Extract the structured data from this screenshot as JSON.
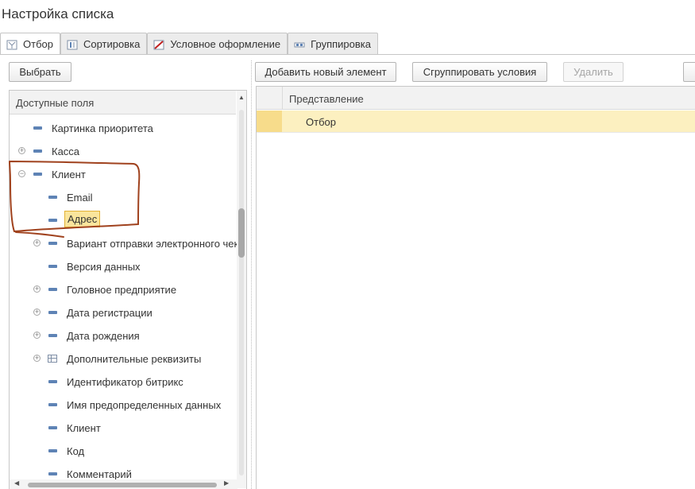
{
  "window": {
    "title": "Настройка списка"
  },
  "tabs": [
    {
      "label": "Отбор",
      "icon": "filter-icon",
      "active": true
    },
    {
      "label": "Сортировка",
      "icon": "sort-icon",
      "active": false
    },
    {
      "label": "Условное оформление",
      "icon": "conditional-format-icon",
      "active": false
    },
    {
      "label": "Группировка",
      "icon": "grouping-icon",
      "active": false
    }
  ],
  "left": {
    "select_button": "Выбрать",
    "header": "Доступные поля",
    "items": [
      {
        "label": "Картинка приоритета",
        "expandable": false,
        "icon": "field-icon"
      },
      {
        "label": "Касса",
        "expandable": true,
        "expanded": false,
        "icon": "field-icon"
      },
      {
        "label": "Клиент",
        "expandable": true,
        "expanded": true,
        "icon": "field-icon"
      },
      {
        "label": "Email",
        "expandable": false,
        "icon": "field-icon"
      },
      {
        "label": "Адрес",
        "expandable": false,
        "icon": "field-icon",
        "highlighted": true
      },
      {
        "label": "Вариант отправки электронного чек",
        "expandable": true,
        "expanded": false,
        "icon": "field-icon"
      },
      {
        "label": "Версия данных",
        "expandable": false,
        "icon": "field-icon"
      },
      {
        "label": "Головное предприятие",
        "expandable": true,
        "expanded": false,
        "icon": "field-icon"
      },
      {
        "label": "Дата регистрации",
        "expandable": true,
        "expanded": false,
        "icon": "field-icon"
      },
      {
        "label": "Дата рождения",
        "expandable": true,
        "expanded": false,
        "icon": "field-icon"
      },
      {
        "label": "Дополнительные реквизиты",
        "expandable": true,
        "expanded": false,
        "icon": "table-icon"
      },
      {
        "label": "Идентификатор битрикс",
        "expandable": false,
        "icon": "field-icon"
      },
      {
        "label": "Имя предопределенных данных",
        "expandable": false,
        "icon": "field-icon"
      },
      {
        "label": "Клиент",
        "expandable": false,
        "icon": "field-icon"
      },
      {
        "label": "Код",
        "expandable": false,
        "icon": "field-icon"
      },
      {
        "label": "Комментарий",
        "expandable": false,
        "icon": "field-icon"
      }
    ]
  },
  "right": {
    "add_button": "Добавить новый элемент",
    "group_button": "Сгруппировать условия",
    "delete_button": "Удалить",
    "column_header": "Представление",
    "rows": [
      {
        "label": "Отбор",
        "selected": true
      }
    ]
  },
  "colors": {
    "selection_row": "#fcf0c0",
    "highlight": "#fae59c",
    "annotation": "#a0421e",
    "field_icon": "#5e83b5"
  }
}
